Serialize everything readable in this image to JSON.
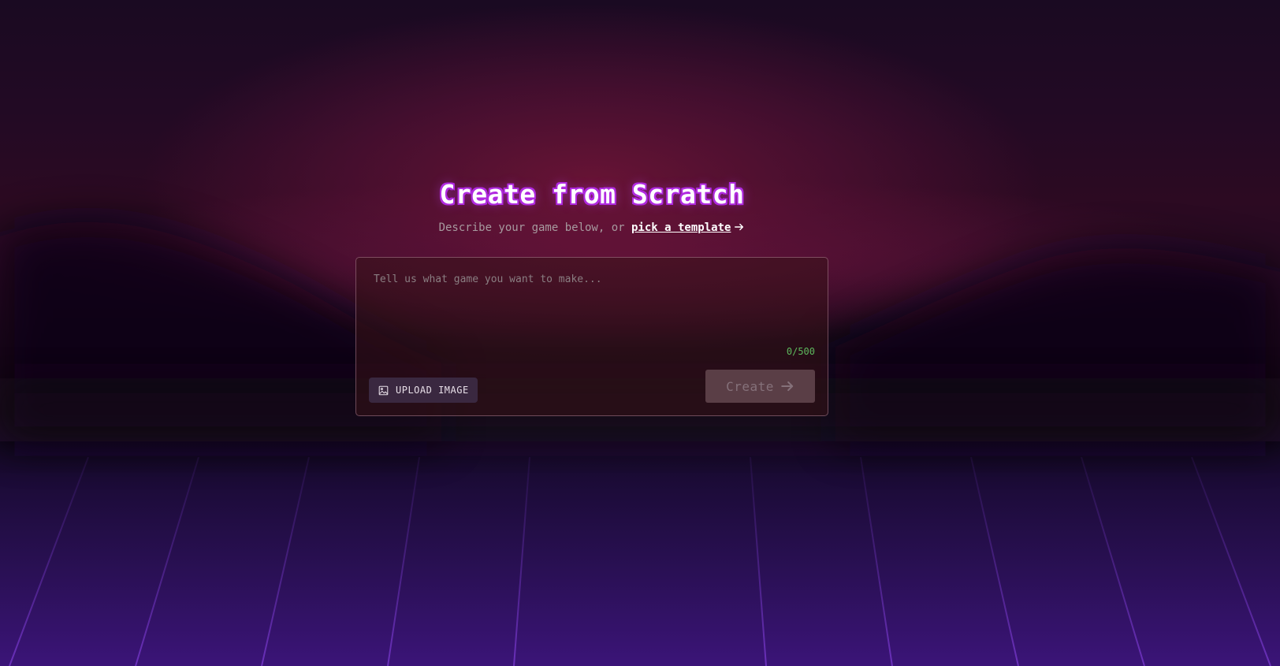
{
  "hero": {
    "title": "Create from Scratch",
    "subtitle_prefix": "Describe your game below, or ",
    "template_link": "pick a template"
  },
  "composer": {
    "placeholder": "Tell us what game you want to make...",
    "value": "",
    "char_count": "0/500",
    "upload_label": "UPLOAD IMAGE",
    "create_label": "Create"
  },
  "theme": {
    "title_outline": "#b02ae0",
    "counter_color": "#5db85d",
    "create_disabled_bg": "#5a3e46"
  },
  "icons": {
    "template_arrow": "arrow-right-icon",
    "upload": "image-icon",
    "create_arrow": "arrow-right-icon"
  }
}
